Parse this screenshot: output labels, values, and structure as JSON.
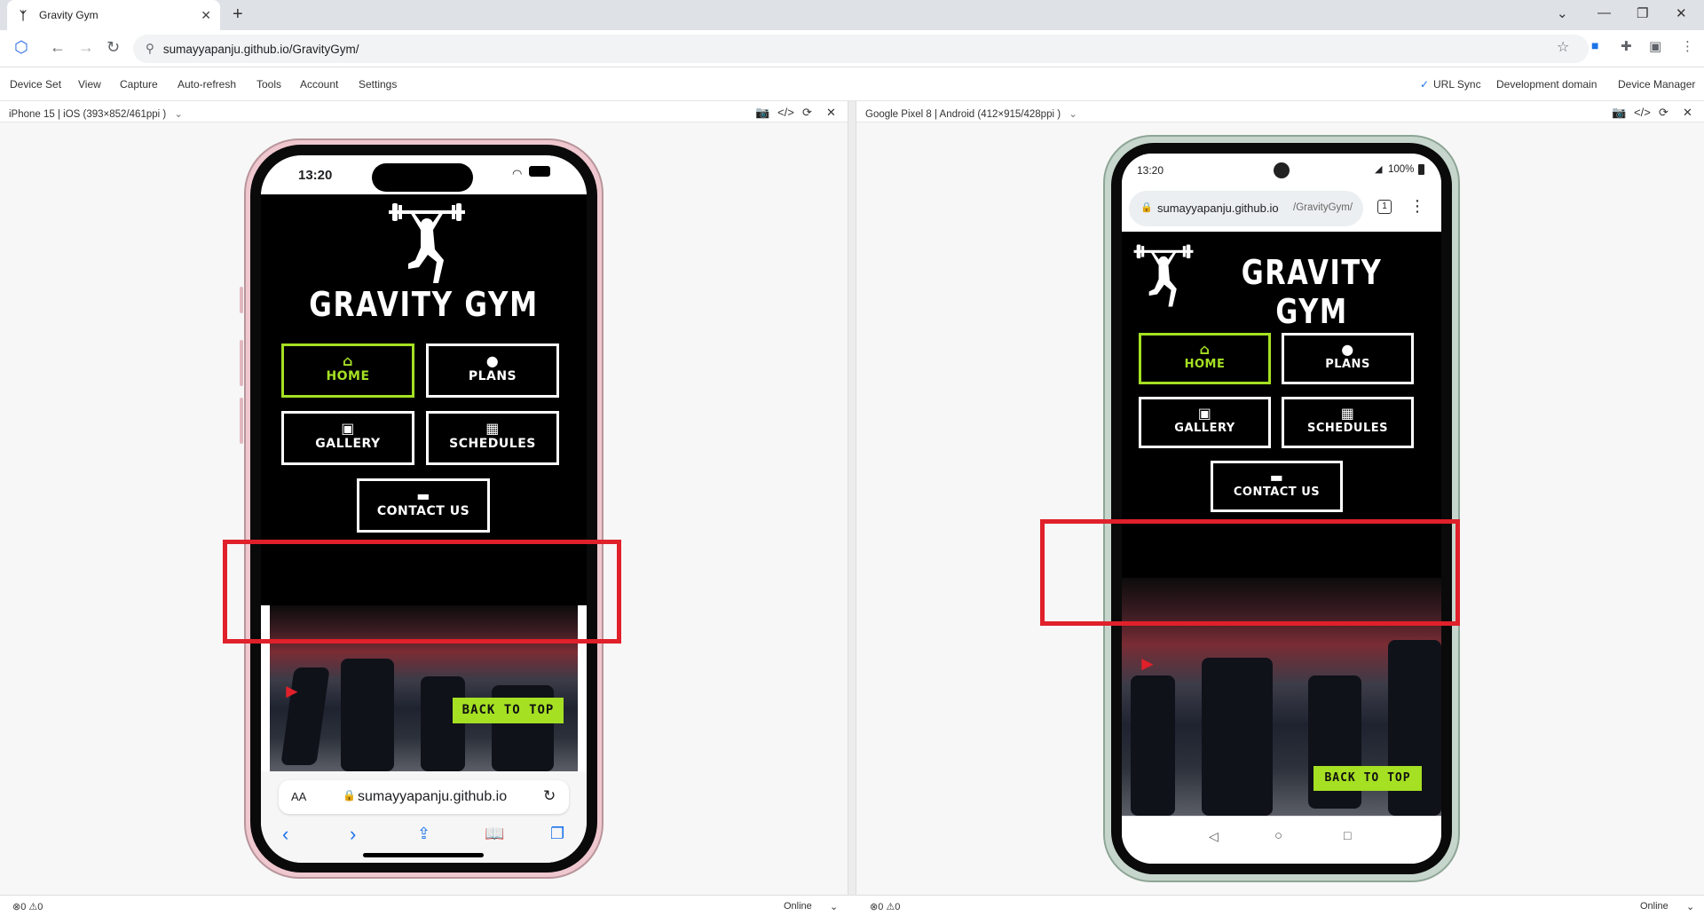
{
  "browser": {
    "tab_title": "Gravity Gym",
    "new_tab": "+",
    "url": "sumayyapanju.github.io/GravityGym/"
  },
  "toolbar": {
    "menu": [
      "Device Set",
      "View",
      "Capture",
      "Auto-refresh",
      "Tools",
      "Account",
      "Settings"
    ],
    "right": {
      "url_sync": "URL Sync",
      "dev_domain": "Development domain",
      "device_manager": "Device Manager"
    }
  },
  "left_pane": {
    "device_label": "iPhone 15 | iOS (393×852/461ppi )",
    "status_time": "13:20",
    "site": {
      "title": "GRAVITY GYM",
      "nav": [
        {
          "label": "HOME",
          "icon": "⌂"
        },
        {
          "label": "PLANS",
          "icon": "●"
        },
        {
          "label": "GALLERY",
          "icon": "▣"
        },
        {
          "label": "SCHEDULES",
          "icon": "▦"
        },
        {
          "label": "CONTACT US",
          "icon": "▬"
        }
      ],
      "back_to_top": "BACK TO TOP"
    },
    "safari": {
      "aa": "AA",
      "url": "sumayyapanju.github.io"
    }
  },
  "right_pane": {
    "device_label": "Google Pixel 8 | Android (412×915/428ppi )",
    "status_time": "13:20",
    "battery": "100%",
    "url_host": "sumayyapanju.github.io",
    "url_path": "/GravityGym/",
    "tabs_count": "1",
    "site": {
      "title": "GRAVITY GYM",
      "nav": [
        {
          "label": "HOME",
          "icon": "⌂"
        },
        {
          "label": "PLANS",
          "icon": "●"
        },
        {
          "label": "GALLERY",
          "icon": "▣"
        },
        {
          "label": "SCHEDULES",
          "icon": "▦"
        },
        {
          "label": "CONTACT US",
          "icon": "▬"
        }
      ],
      "back_to_top": "BACK TO TOP"
    }
  },
  "status": {
    "left_counts": "⊗0 ⚠0",
    "online": "Online"
  },
  "colors": {
    "accent": "#a5e023",
    "highlight": "#e0202a"
  }
}
